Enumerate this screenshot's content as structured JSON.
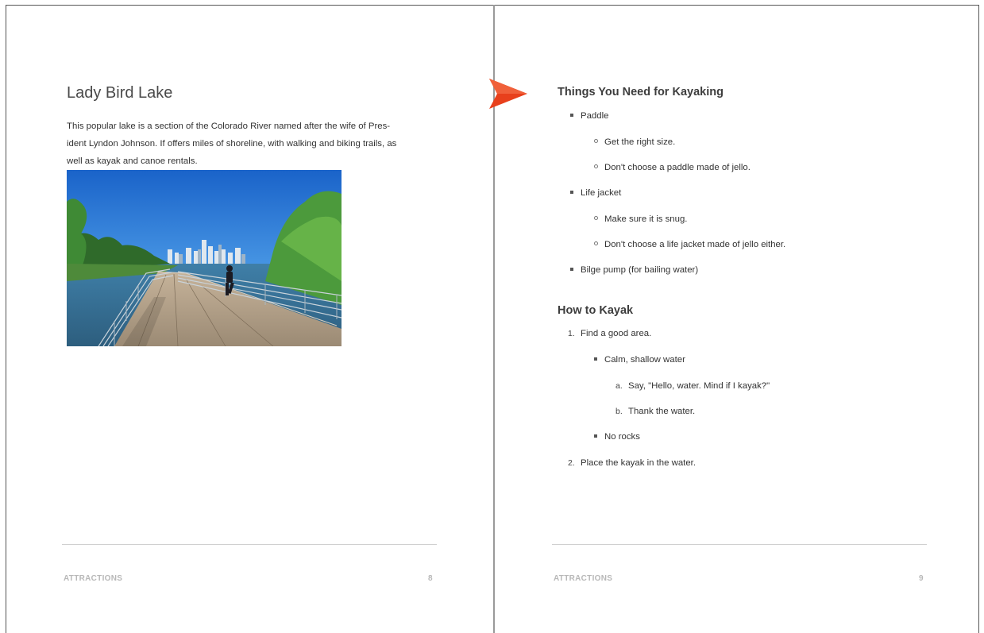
{
  "left_page": {
    "title": "Lady Bird Lake",
    "paragraph_lines": [
      "This popular lake is a section of the Colorado River named after the wife of Pres-",
      "ident Lyndon Johnson. If offers miles of shoreline, with walking and biking trails, as",
      "well as kayak and canoe rentals."
    ],
    "footer_label": "ATTRACTIONS",
    "page_number": "8"
  },
  "right_page": {
    "heading_gear": "Things You Need for Kayaking",
    "gear": {
      "paddle": "Paddle",
      "paddle_sub1": "Get the right size.",
      "paddle_sub2": "Don't choose a paddle made of jello.",
      "life_jacket": "Life jacket",
      "life_jacket_sub1": "Make sure it is snug.",
      "life_jacket_sub2": "Don't choose a life jacket made of jello either.",
      "bilge_pump": "Bilge pump (for bailing water)"
    },
    "heading_howto": "How to Kayak",
    "steps": {
      "s1_marker": "1.",
      "s1": "Find a good area.",
      "s1_b1": "Calm, shallow water",
      "s1_b1_a_marker": "a.",
      "s1_b1_a": "Say, \"Hello, water. Mind if I kayak?\"",
      "s1_b1_b_marker": "b.",
      "s1_b1_b": "Thank the water.",
      "s1_b2": "No rocks",
      "s2_marker": "2.",
      "s2": "Place the kayak in the water."
    },
    "footer_label": "ATTRACTIONS",
    "page_number": "9"
  },
  "colors": {
    "accent_arrow": "#e8401c",
    "footer_text": "#b8b8b8",
    "rule": "#cfcfcf"
  },
  "icons": {
    "bookmark_arrow": "arrow-pointer-icon"
  }
}
